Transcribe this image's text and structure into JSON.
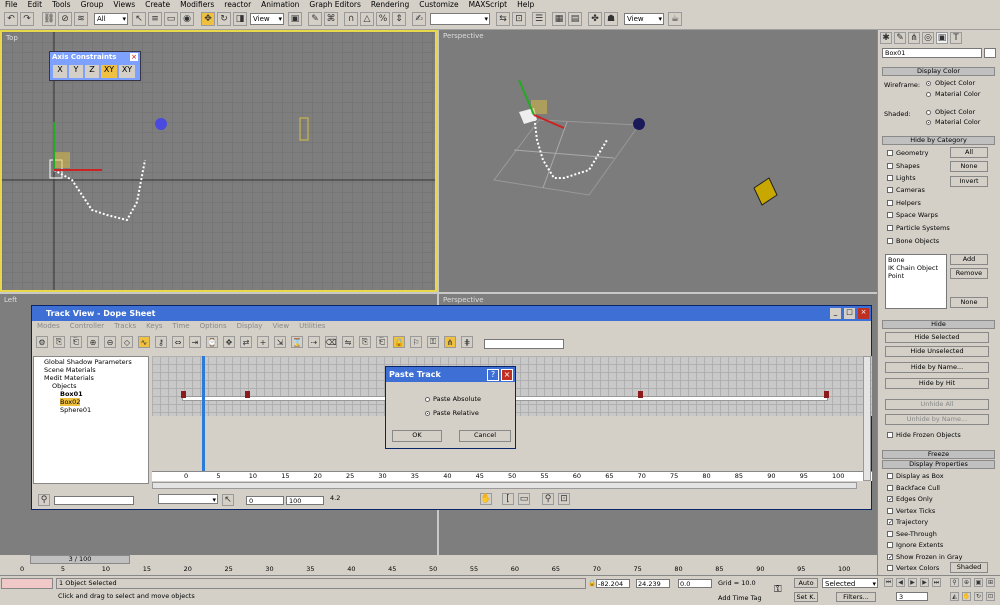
{
  "menu": [
    "File",
    "Edit",
    "Tools",
    "Group",
    "Views",
    "Create",
    "Modifiers",
    "reactor",
    "Animation",
    "Graph Editors",
    "Rendering",
    "Customize",
    "MAXScript",
    "Help"
  ],
  "toolbar": {
    "filter_value": "All",
    "ref_coord_value": "View",
    "ref_coord2_value": "View"
  },
  "viewports": {
    "top_label": "Top",
    "perspective_label": "Perspective",
    "left_label": "Left",
    "perspective2_label": "Perspective"
  },
  "axis_constraints": {
    "title": "Axis Constraints",
    "buttons": [
      "X",
      "Y",
      "Z",
      "XY",
      "XY"
    ]
  },
  "track_view": {
    "title": "Track View - Dope Sheet",
    "menu": [
      "Modes",
      "Controller",
      "Tracks",
      "Keys",
      "Time",
      "Options",
      "Display",
      "View",
      "Utilities"
    ],
    "tree": [
      {
        "label": "Global Shadow Parameters"
      },
      {
        "label": "Scene Materials"
      },
      {
        "label": "Medit Materials"
      },
      {
        "label": "Objects"
      },
      {
        "label": "Box01"
      },
      {
        "label": "Box02"
      },
      {
        "label": "Sphere01"
      }
    ],
    "ruler": [
      "0",
      "5",
      "10",
      "15",
      "20",
      "25",
      "30",
      "35",
      "40",
      "45",
      "50",
      "55",
      "60",
      "65",
      "70",
      "75",
      "80",
      "85",
      "90",
      "95",
      "100"
    ],
    "bottom_fields": {
      "field1": "0",
      "field2": "100",
      "zoom": "4.2"
    }
  },
  "paste_dialog": {
    "title": "Paste Track",
    "opt1": "Paste Absolute",
    "opt2": "Paste Relative",
    "ok": "OK",
    "cancel": "Cancel",
    "selected": "Paste Relative"
  },
  "command_panel": {
    "name_field": "Box01",
    "display_color": "Display Color",
    "wireframe_label": "Wireframe:",
    "shaded_label": "Shaded:",
    "object_color": "Object Color",
    "material_color": "Material Color",
    "hide_by_category": "Hide by Category",
    "categories": [
      "Geometry",
      "Shapes",
      "Lights",
      "Cameras",
      "Helpers",
      "Space Warps",
      "Particle Systems",
      "Bone Objects"
    ],
    "cat_buttons": [
      "All",
      "None",
      "Invert"
    ],
    "list_items": [
      "Bone",
      "IK Chain Object",
      "Point"
    ],
    "list_buttons": [
      "Add",
      "Remove",
      "None"
    ],
    "hide": "Hide",
    "hide_buttons": [
      "Hide Selected",
      "Hide Unselected",
      "Hide by Name...",
      "Hide by Hit",
      "Unhide All",
      "Unhide by Name..."
    ],
    "hide_frozen": "Hide Frozen Objects",
    "freeze": "Freeze",
    "display_properties": "Display Properties",
    "props": [
      "Display as Box",
      "Backface Cull",
      "Edges Only",
      "Vertex Ticks",
      "Trajectory",
      "See-Through",
      "Ignore Extents",
      "Show Frozen in Gray",
      "Vertex Colors"
    ],
    "props_checked": [
      false,
      false,
      true,
      false,
      true,
      false,
      false,
      true,
      false
    ],
    "shaded_btn": "Shaded"
  },
  "timeline": {
    "frame": "3 / 100",
    "ticks": [
      "0",
      "5",
      "10",
      "15",
      "20",
      "25",
      "30",
      "35",
      "40",
      "45",
      "50",
      "55",
      "60",
      "65",
      "70",
      "75",
      "80",
      "85",
      "90",
      "95",
      "100"
    ]
  },
  "status": {
    "selected": "1 Object Selected",
    "prompt": "Click and drag to select and move objects",
    "x": "-82.204",
    "y": "24.239",
    "z": "0.0",
    "grid": "Grid = 10.0",
    "add_time_tag": "Add Time Tag",
    "auto": "Auto",
    "set_key": "Set K.",
    "selected_dd": "Selected",
    "filters": "Filters...",
    "frame_field": "3"
  }
}
